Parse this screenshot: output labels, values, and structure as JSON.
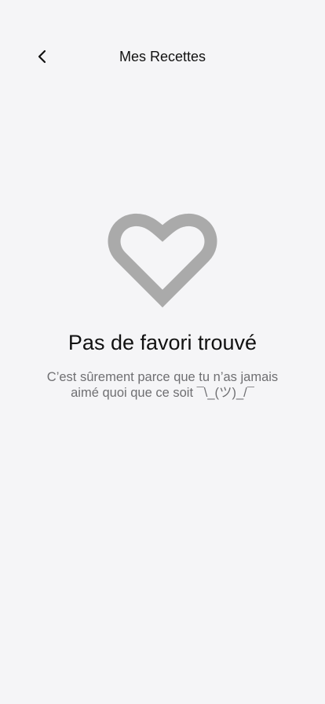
{
  "header": {
    "back_icon": "chevron-left-icon",
    "title": "Mes Recettes"
  },
  "empty_state": {
    "icon": "heart-outline-icon",
    "icon_color": "#aaaaaa",
    "title": "Pas de favori trouvé",
    "subtitle_line1": "C’est sûrement parce que tu n’as jamais",
    "subtitle_line2": "aimé quoi que ce soit ¯\\_(ツ)_/¯"
  },
  "colors": {
    "background": "#f5f5f7",
    "text_primary": "#111111",
    "text_secondary": "#6f6f72"
  }
}
